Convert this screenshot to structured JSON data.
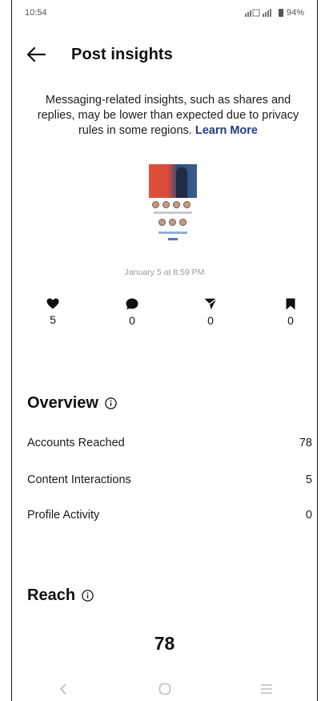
{
  "status_bar": {
    "time": "10:54",
    "battery": "94%"
  },
  "header": {
    "title": "Post insights",
    "back_icon": "arrow-left-icon"
  },
  "notice": {
    "text": "Messaging-related insights, such as shares and replies, may be lower than expected due to privacy rules in some regions.",
    "link_label": "Learn More",
    "link_color": "#1f3b86"
  },
  "post": {
    "date": "January 5 at 8:59 PM"
  },
  "metrics": [
    {
      "icon": "heart-icon",
      "value": "5"
    },
    {
      "icon": "comment-icon",
      "value": "0"
    },
    {
      "icon": "share-icon",
      "value": "0"
    },
    {
      "icon": "bookmark-icon",
      "value": "0"
    }
  ],
  "overview": {
    "title": "Overview",
    "rows": [
      {
        "label": "Accounts Reached",
        "value": "78"
      },
      {
        "label": "Content Interactions",
        "value": "5"
      },
      {
        "label": "Profile Activity",
        "value": "0"
      }
    ]
  },
  "reach": {
    "title": "Reach",
    "value": "78"
  },
  "nav_bar": {
    "buttons": [
      "back-nav-icon",
      "home-nav-icon",
      "recents-nav-icon"
    ]
  }
}
